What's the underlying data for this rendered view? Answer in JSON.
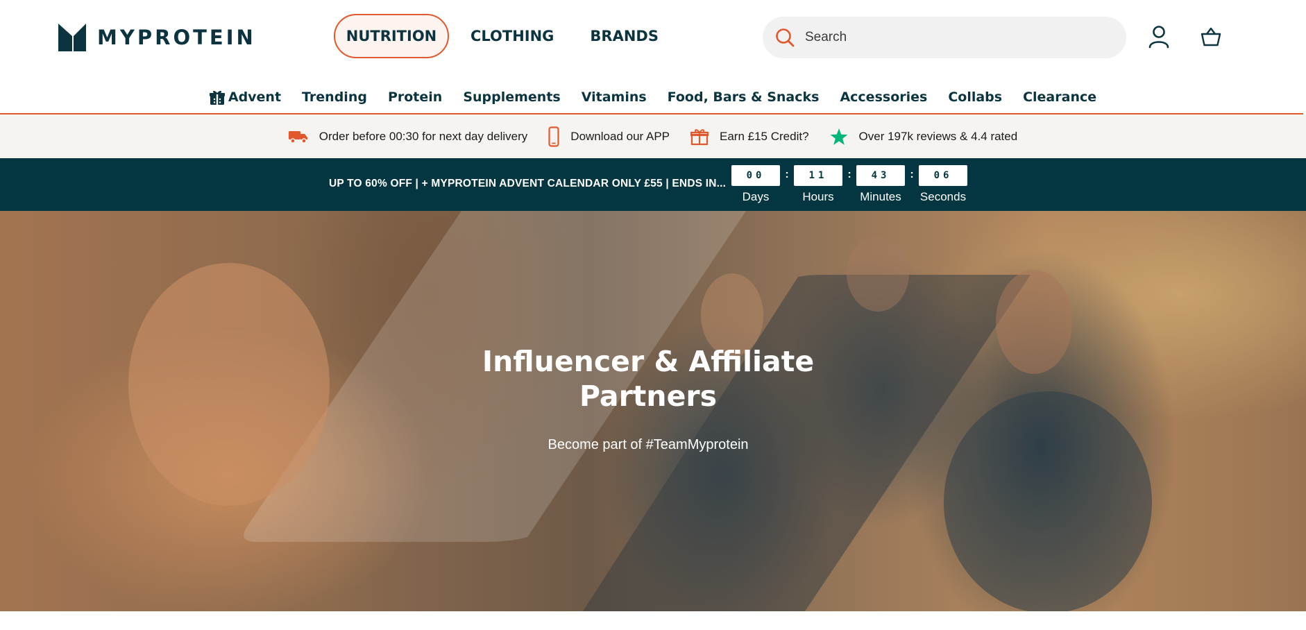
{
  "brand": {
    "name": "MYPROTEIN",
    "accent": "#e2572c",
    "primary": "#0b3440",
    "promo_bg": "#033640"
  },
  "top_nav": [
    {
      "label": "NUTRITION",
      "active": true
    },
    {
      "label": "CLOTHING",
      "active": false
    },
    {
      "label": "BRANDS",
      "active": false
    }
  ],
  "search": {
    "placeholder": "Search"
  },
  "header_icons": [
    "search-icon",
    "account-icon",
    "basket-icon"
  ],
  "sub_nav": [
    {
      "label": "Advent",
      "icon": "gift-icon"
    },
    {
      "label": "Trending"
    },
    {
      "label": "Protein"
    },
    {
      "label": "Supplements"
    },
    {
      "label": "Vitamins"
    },
    {
      "label": "Food, Bars & Snacks"
    },
    {
      "label": "Accessories"
    },
    {
      "label": "Collabs"
    },
    {
      "label": "Clearance"
    }
  ],
  "usp": [
    {
      "icon": "truck-icon",
      "text": "Order before 00:30 for next day delivery"
    },
    {
      "icon": "phone-icon",
      "text": "Download our APP"
    },
    {
      "icon": "gift-icon",
      "text": "Earn £15 Credit?"
    },
    {
      "icon": "star-icon",
      "text": "Over 197k reviews & 4.4 rated"
    }
  ],
  "promo": {
    "text": "UP TO 60% OFF | + MYPROTEIN ADVENT CALENDAR ONLY £55 | ENDS IN...",
    "countdown": [
      {
        "value": "00",
        "label": "Days"
      },
      {
        "value": "11",
        "label": "Hours"
      },
      {
        "value": "43",
        "label": "Minutes"
      },
      {
        "value": "06",
        "label": "Seconds"
      }
    ],
    "separator": ":"
  },
  "hero": {
    "title": "Influencer & Affiliate Partners",
    "subtitle": "Become part of #TeamMyprotein"
  }
}
